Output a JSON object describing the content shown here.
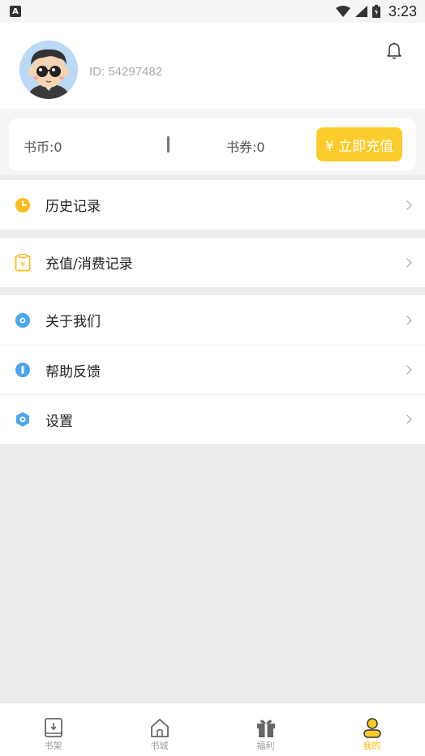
{
  "status_bar": {
    "time": "3:23",
    "notification_letter": "A"
  },
  "profile": {
    "user_id": "ID: 54297482"
  },
  "wallet": {
    "coins": "书币:0",
    "vouchers": "书券:0",
    "recharge_label": "¥ 立即充值"
  },
  "menu": {
    "history": "历史记录",
    "records": "充值/消费记录",
    "about": "关于我们",
    "help": "帮助反馈",
    "settings": "设置"
  },
  "nav": {
    "bookshelf": "书架",
    "bookstore": "书城",
    "welfare": "福利",
    "mine": "我的"
  },
  "colors": {
    "accent": "#fccc2c",
    "active_nav": "#f5b800",
    "blue_icon": "#4aa6f0"
  }
}
